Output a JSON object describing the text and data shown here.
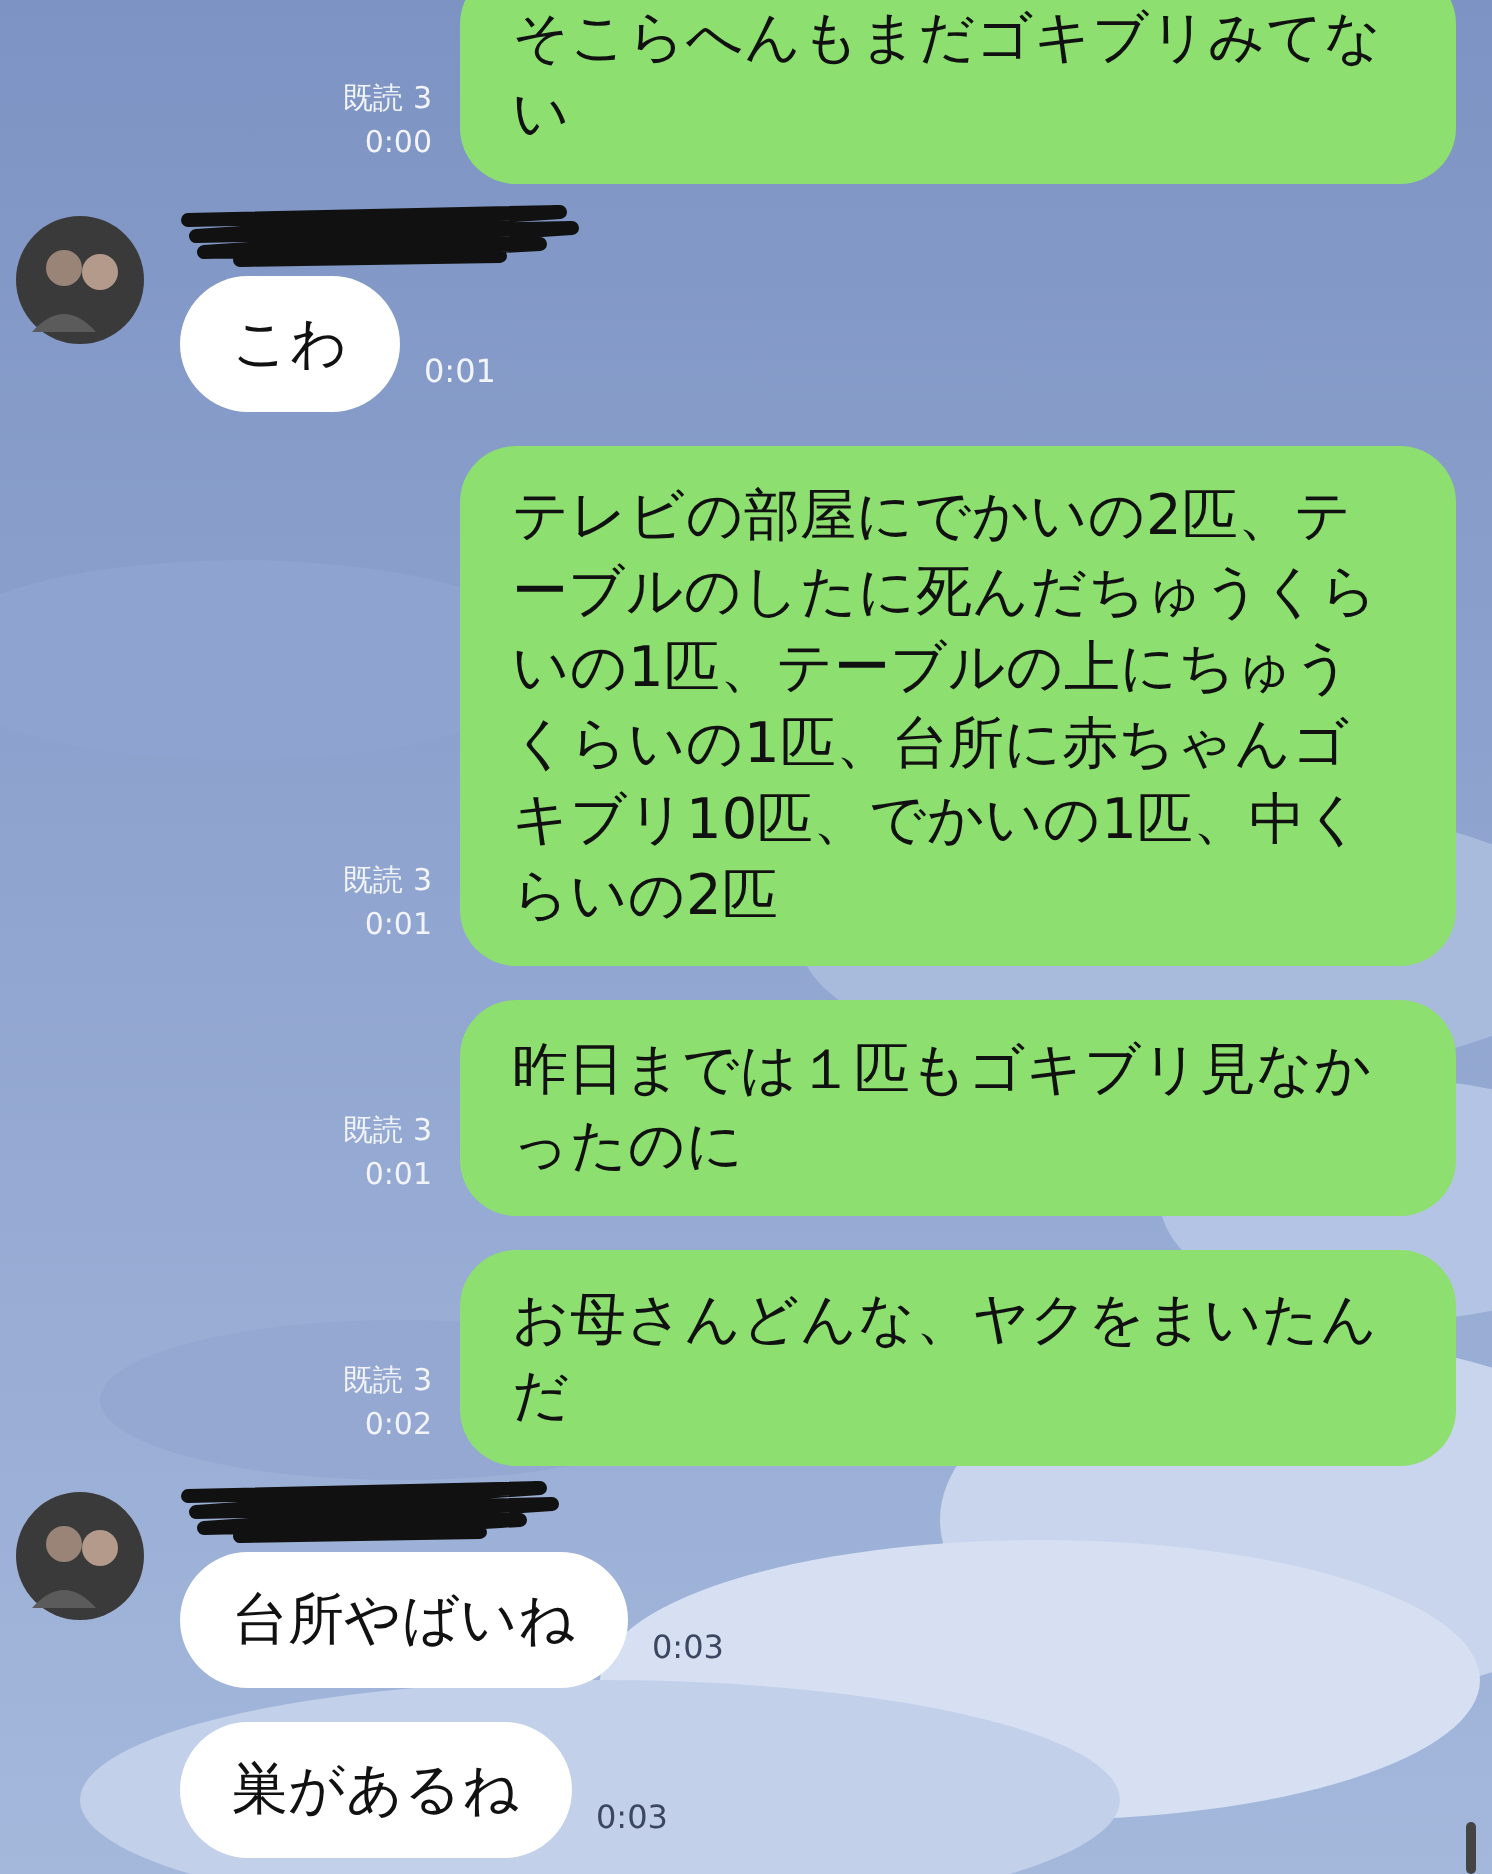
{
  "messages": [
    {
      "kind": "sent",
      "text": "そこらへんもまだゴキブリみてない",
      "read": "既読 3",
      "time": "0:00"
    },
    {
      "kind": "received",
      "show_sender": true,
      "bubbles": [
        {
          "text": "こわ",
          "time": "0:01"
        }
      ]
    },
    {
      "kind": "sent",
      "text": "テレビの部屋にでかいの2匹、テーブルのしたに死んだちゅうくらいの1匹、テーブルの上にちゅうくらいの1匹、台所に赤ちゃんゴキブリ10匹、でかいの1匹、中くらいの2匹",
      "read": "既読 3",
      "time": "0:01"
    },
    {
      "kind": "sent",
      "text": "昨日までは１匹もゴキブリ見なかったのに",
      "read": "既読 3",
      "time": "0:01"
    },
    {
      "kind": "sent",
      "text": "お母さんどんな、ヤクをまいたんだ",
      "read": "既読 3",
      "time": "0:02"
    },
    {
      "kind": "received",
      "show_sender": true,
      "bubbles": [
        {
          "text": "台所やばいね",
          "time": "0:03"
        },
        {
          "text": "巣があるね",
          "time": "0:03"
        }
      ]
    }
  ]
}
